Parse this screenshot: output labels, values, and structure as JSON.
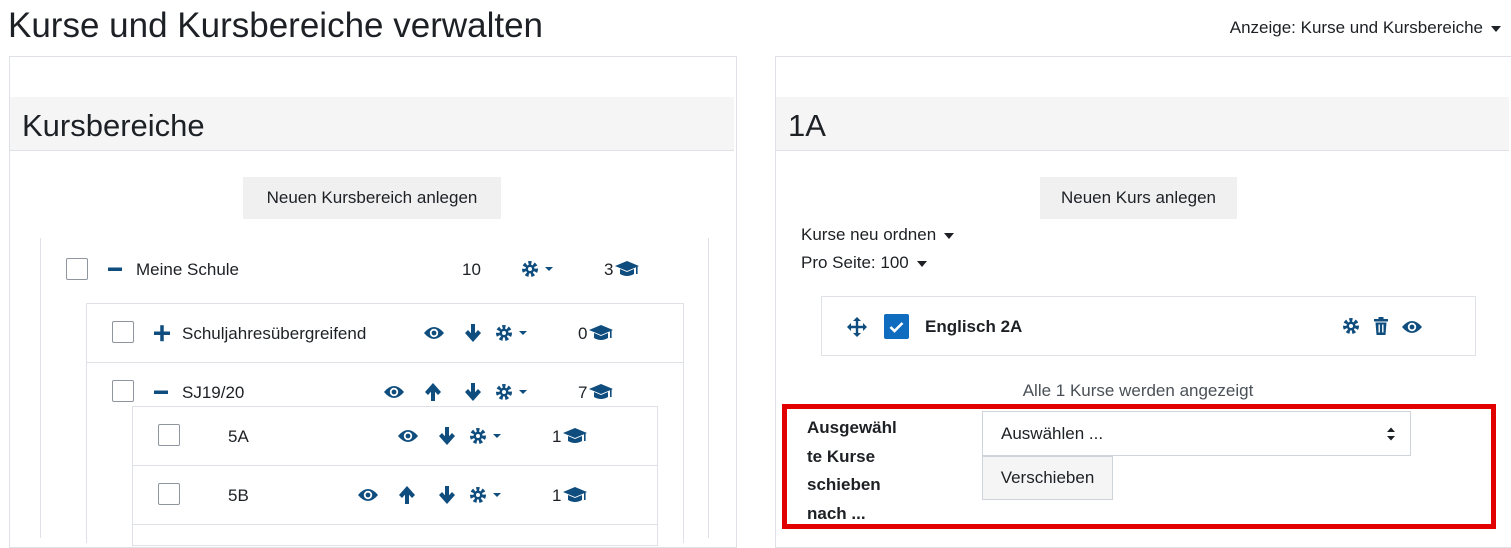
{
  "page": {
    "title": "Kurse und Kursbereiche verwalten",
    "view_label": "Anzeige: Kurse und Kursbereiche"
  },
  "categories_panel": {
    "title": "Kursbereiche",
    "new_category_button": "Neuen Kursbereich anlegen",
    "items": [
      {
        "name": "Meine Schule",
        "subcategories": "10",
        "courses": "3",
        "expanded": true
      },
      {
        "name": "Schuljahresübergreifend",
        "courses": "0",
        "expanded": false
      },
      {
        "name": "SJ19/20",
        "courses": "7",
        "expanded": true
      },
      {
        "name": "5A",
        "courses": "1"
      },
      {
        "name": "5B",
        "courses": "1"
      }
    ]
  },
  "courses_panel": {
    "title": "1A",
    "new_course_button": "Neuen Kurs anlegen",
    "sort_label": "Kurse neu ordnen",
    "per_page_label": "Pro Seite: 100",
    "courses": [
      {
        "name": "Englisch 2A",
        "checked": true
      }
    ],
    "listing_info": "Alle 1 Kurse werden angezeigt",
    "move": {
      "label": "Ausgewählte Kurse schieben nach ...",
      "label_lines": [
        "Ausgewähl",
        "te Kurse",
        "schieben",
        "nach ..."
      ],
      "select_value": "Auswählen ...",
      "move_button": "Verschieben"
    }
  },
  "colors": {
    "accent": "#0f6cbf",
    "icon": "#0f4d7e",
    "highlight": "#e00000"
  }
}
